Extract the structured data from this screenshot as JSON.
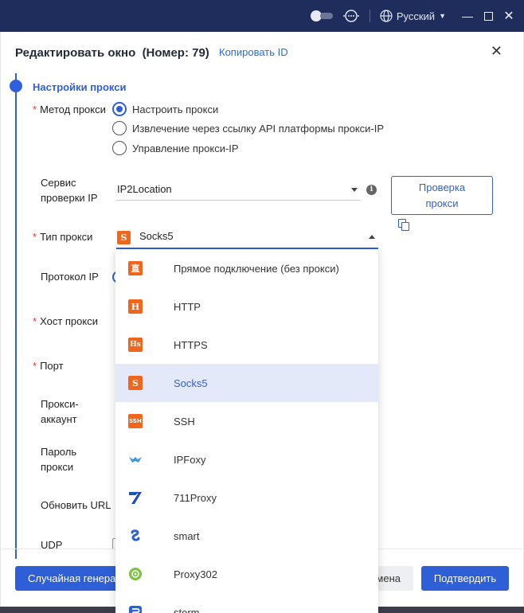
{
  "titlebar": {
    "language": "Русский"
  },
  "dialog": {
    "title": "Редактировать окно  (Номер: 79)",
    "copy_id": "Копировать ID",
    "section_title": "Настройки прокси",
    "proxy_method": {
      "label": "Метод прокси",
      "options": [
        {
          "label": "Настроить прокси",
          "selected": true
        },
        {
          "label": "Извлечение через ссылку API платформы прокси-IP",
          "selected": false
        },
        {
          "label": "Управление прокси-IP",
          "selected": false
        }
      ]
    },
    "ip_check": {
      "label_line1": "Сервис",
      "label_line2": "проверки IP",
      "value": "IP2Location",
      "check_button_line1": "Проверка",
      "check_button_line2": "прокси"
    },
    "proxy_type": {
      "label": "Тип прокси",
      "value": "Socks5"
    },
    "ip_protocol": {
      "label": "Протокол IP"
    },
    "proxy_host": {
      "label": "Хост прокси"
    },
    "port": {
      "label": "Порт"
    },
    "proxy_account": {
      "label_line1": "Прокси-",
      "label_line2": "аккаунт"
    },
    "proxy_password": {
      "label_line1": "Пароль",
      "label_line2": "прокси"
    },
    "refresh_url": {
      "label": "Обновить URL"
    },
    "udp": {
      "label": "UDP"
    }
  },
  "footer": {
    "random_button": "Случайная генерация",
    "cancel_button": "Отмена",
    "confirm_button": "Подтвердить"
  },
  "dropdown": {
    "options": [
      {
        "label": "Прямое подключение (без прокси)",
        "icon": "direct-icon",
        "icon_char": "直"
      },
      {
        "label": "HTTP",
        "icon": "http-icon",
        "icon_char": "H"
      },
      {
        "label": "HTTPS",
        "icon": "https-icon",
        "icon_char": "Hs"
      },
      {
        "label": "Socks5",
        "icon": "socks5-icon",
        "icon_char": "S"
      },
      {
        "label": "SSH",
        "icon": "ssh-icon",
        "icon_char": "SSH"
      },
      {
        "label": "IPFoxy",
        "icon": "ipfoxy-icon"
      },
      {
        "label": "711Proxy",
        "icon": "711proxy-icon"
      },
      {
        "label": "smart",
        "icon": "smart-icon"
      },
      {
        "label": "Proxy302",
        "icon": "proxy302-icon"
      },
      {
        "label": "storm",
        "icon": "storm-icon"
      }
    ],
    "selected_index": 3
  },
  "colors": {
    "accent": "#2f5fd6",
    "titlebar": "#1f2d5c",
    "required": "#e23b2e",
    "proxy_icon": "#f0661c"
  },
  "icons": {
    "s_icon_char": "S"
  }
}
